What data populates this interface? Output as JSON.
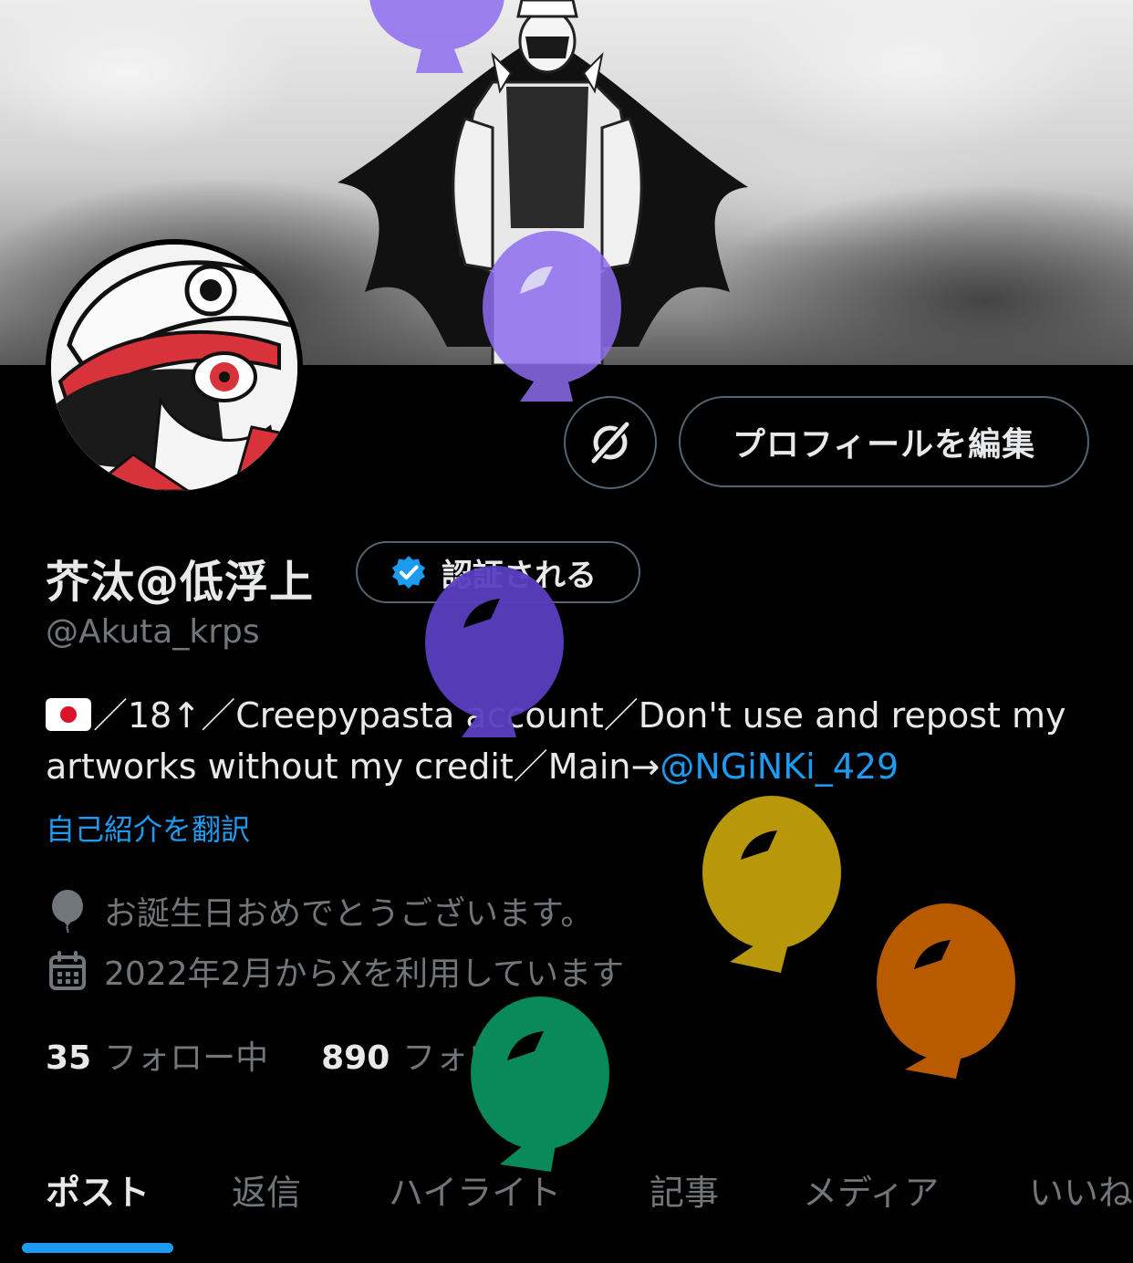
{
  "profile": {
    "display_name": "芥汰@低浮上",
    "verify_label": "認証される",
    "handle": "@Akuta_krps",
    "edit_profile_label": "プロフィールを編集",
    "bio": {
      "text": "／18↑／Creepypasta account／Don't use and repost my artworks without my credit／Main→",
      "mention": "@NGiNKi_429"
    },
    "translate_label": "自己紹介を翻訳",
    "birthday_text": "お誕生日おめでとうございます。",
    "joined_text": "2022年2月からXを利用しています",
    "following": {
      "count": "35",
      "label": "フォロー中"
    },
    "followers": {
      "count": "890",
      "label": "フォロワー"
    }
  },
  "tabs": [
    {
      "label": "ポスト",
      "active": true
    },
    {
      "label": "返信",
      "active": false
    },
    {
      "label": "ハイライト",
      "active": false
    },
    {
      "label": "記事",
      "active": false
    },
    {
      "label": "メディア",
      "active": false
    },
    {
      "label": "いいね",
      "active": false
    }
  ],
  "icons": {
    "birthday": "balloon-icon",
    "joined": "calendar-icon",
    "verified": "verified-badge-icon",
    "grok": "grok-icon"
  },
  "colors": {
    "accent": "#1d9bf0",
    "muted": "#71767b",
    "border": "#536471",
    "balloon_purple_light": "#8e6df0",
    "balloon_purple_dark": "#5a3fc0",
    "balloon_yellow": "#b8980a",
    "balloon_orange": "#b85a00",
    "balloon_green": "#0a8a5a"
  }
}
